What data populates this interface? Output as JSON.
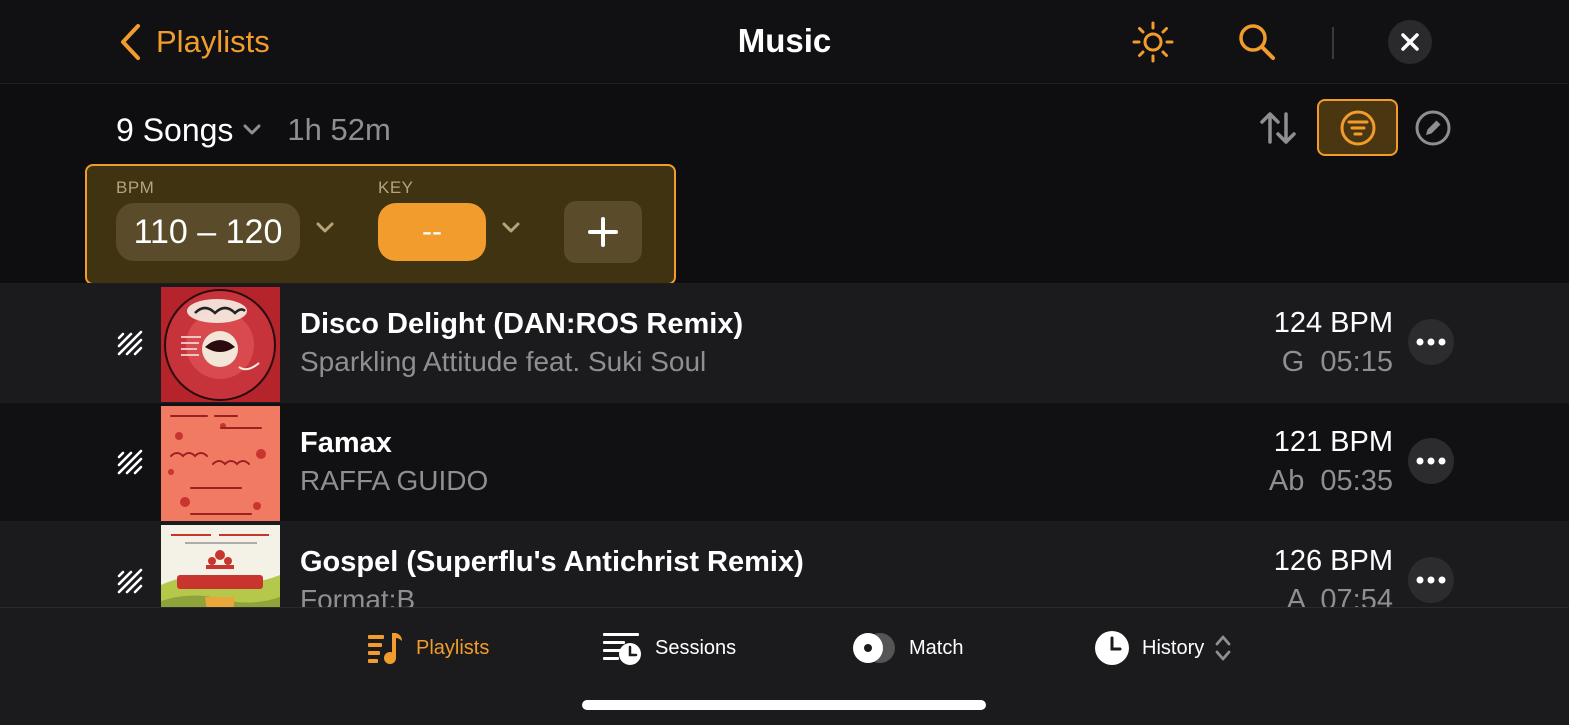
{
  "colors": {
    "accent": "#f19c2c",
    "background": "#0e0e10",
    "secondary_text": "#8e8e93"
  },
  "topbar": {
    "back_label": "Playlists",
    "title": "Music",
    "icons": [
      "brightness-icon",
      "search-icon",
      "close-icon"
    ]
  },
  "header": {
    "songs_count": "9 Songs",
    "duration": "1h 52m",
    "icons": [
      "sort-icon",
      "filter-icon",
      "edit-icon"
    ]
  },
  "filters": {
    "bpm_label": "BPM",
    "bpm_value": "110 – 120",
    "key_label": "KEY",
    "key_value": "--",
    "add_label": "+"
  },
  "songs": [
    {
      "title": "Disco Delight (DAN:ROS Remix)",
      "artist": "Sparkling Attitude feat. Suki Soul",
      "bpm": "124 BPM",
      "key": "G",
      "length": "05:15",
      "art": "Disco Express record label"
    },
    {
      "title": "Famax",
      "artist": "RAFFA GUIDO",
      "bpm": "121 BPM",
      "key": "Ab",
      "length": "05:35",
      "art": "RAFFA Guido Famax cover"
    },
    {
      "title": "Gospel (Superflu's Antichrist Remix)",
      "artist": "Format:B",
      "bpm": "126 BPM",
      "key": "A",
      "length": "07:54",
      "art": "Formatik cover"
    }
  ],
  "tabbar": {
    "tabs": [
      {
        "label": "Playlists",
        "icon": "playlists-icon",
        "active": true
      },
      {
        "label": "Sessions",
        "icon": "sessions-icon",
        "active": false
      },
      {
        "label": "Match",
        "icon": "match-icon",
        "active": false
      },
      {
        "label": "History",
        "icon": "history-icon",
        "active": false
      }
    ]
  }
}
